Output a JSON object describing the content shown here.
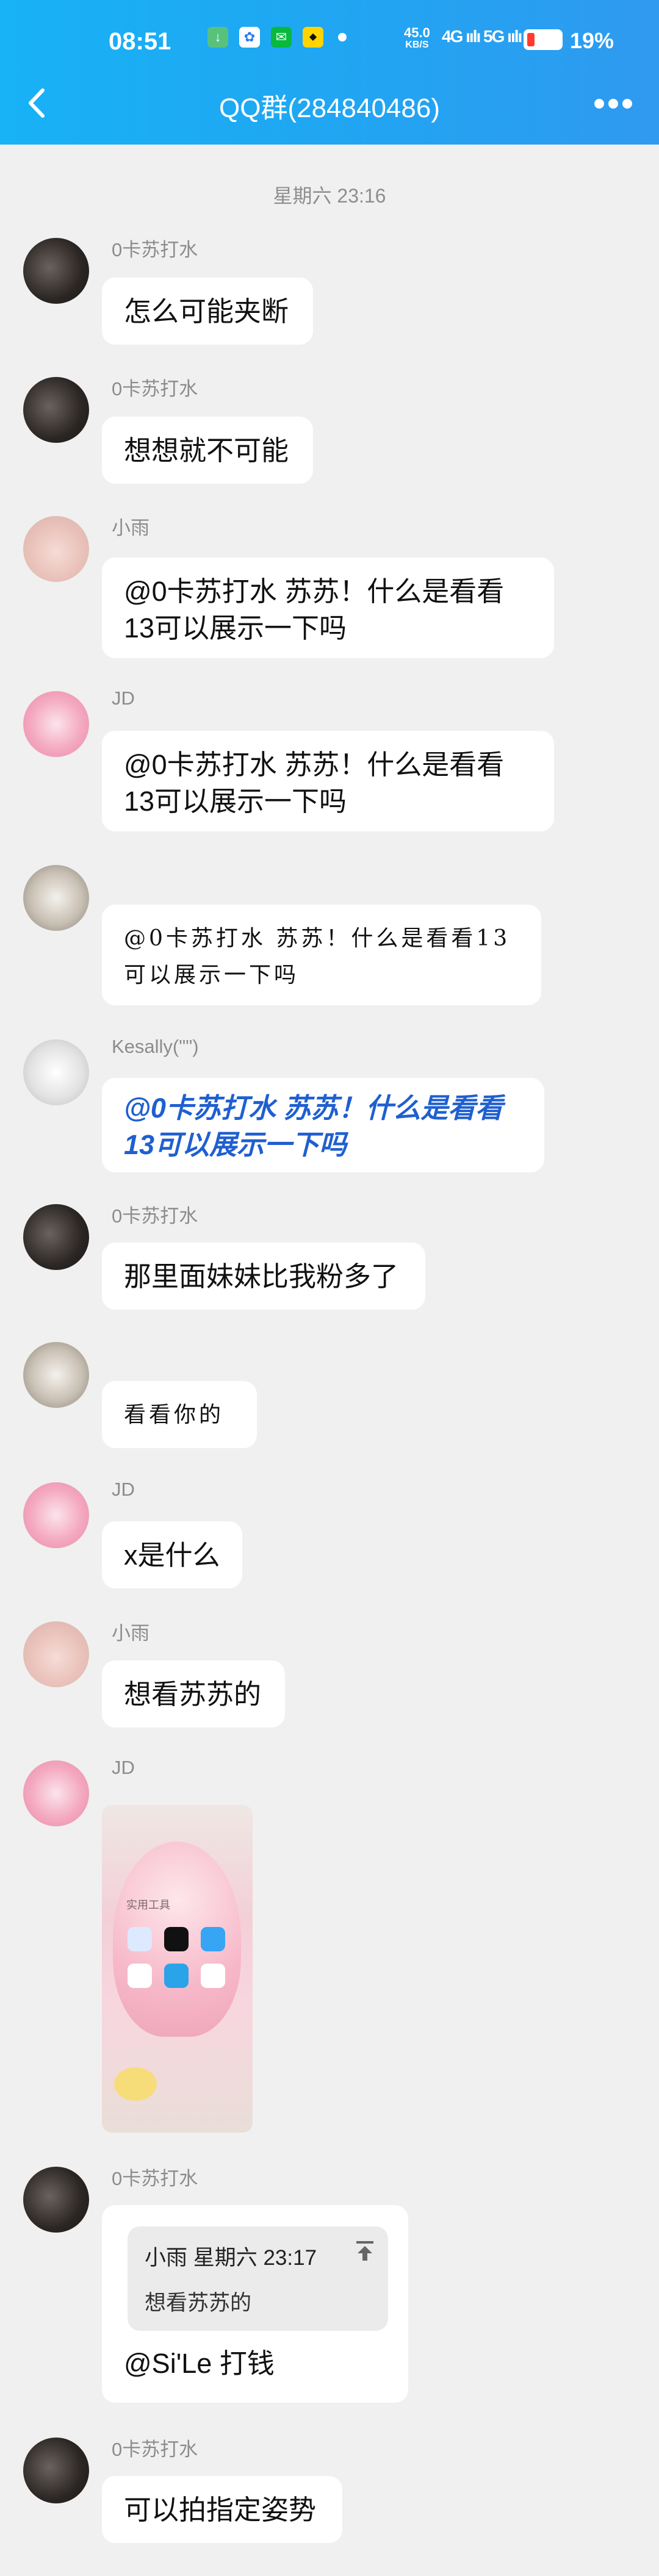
{
  "status": {
    "time": "08:51",
    "net_speed": "45.0",
    "net_unit": "KB/S",
    "signal": "4G ıılı 5G ıılı",
    "battery": "19%"
  },
  "header": {
    "title": "QQ群(284840486)"
  },
  "date": "星期六 23:16",
  "messages": [
    {
      "sender": "0卡苏打水",
      "text": "怎么可能夹断"
    },
    {
      "sender": "0卡苏打水",
      "text": "想想就不可能"
    },
    {
      "sender": "小雨",
      "text": "@0卡苏打水 苏苏！什么是看看13可以展示一下吗"
    },
    {
      "sender": "JD",
      "text": "@0卡苏打水 苏苏！什么是看看13可以展示一下吗"
    },
    {
      "sender": "",
      "text": "@0卡苏打水 苏苏！什么是看看13可以展示一下吗"
    },
    {
      "sender": "Kesally(\"\")",
      "text": "@0卡苏打水 苏苏！什么是看看13可以展示一下吗"
    },
    {
      "sender": "0卡苏打水",
      "text": "那里面妹妹比我粉多了"
    },
    {
      "sender": "",
      "text": "看看你的"
    },
    {
      "sender": "JD",
      "text": "x是什么"
    },
    {
      "sender": "小雨",
      "text": "想看苏苏的"
    },
    {
      "sender": "JD",
      "image_caption": "实用工具"
    },
    {
      "sender": "0卡苏打水",
      "quote_sender": "小雨 星期六 23:17",
      "quote_text": "想看苏苏的",
      "text": "@Si'Le 打钱"
    },
    {
      "sender": "0卡苏打水",
      "text": "可以拍指定姿势"
    }
  ]
}
